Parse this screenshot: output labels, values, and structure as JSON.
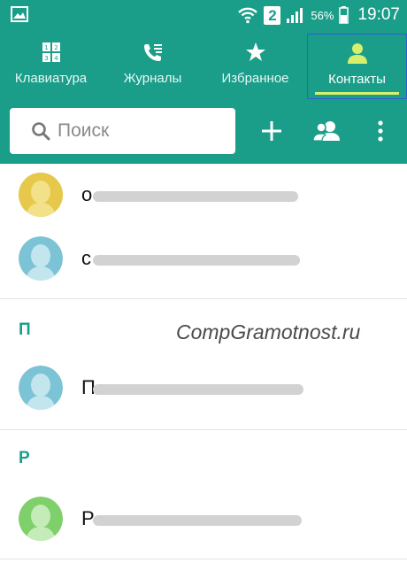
{
  "status_bar": {
    "sim_badge": "2",
    "battery_percent": "56%",
    "time": "19:07",
    "icons": [
      "image-notification-icon",
      "wifi-icon",
      "signal-icon",
      "battery-icon"
    ]
  },
  "tabs": [
    {
      "label": "Клавиатура",
      "icon": "dialpad-icon",
      "active": false
    },
    {
      "label": "Журналы",
      "icon": "call-log-icon",
      "active": false
    },
    {
      "label": "Избранное",
      "icon": "star-icon",
      "active": false
    },
    {
      "label": "Контакты",
      "icon": "contacts-icon",
      "active": true
    }
  ],
  "search": {
    "placeholder": "Поиск",
    "value": ""
  },
  "actions": [
    "add-icon",
    "group-icon",
    "more-icon"
  ],
  "sections": [
    {
      "letter": "",
      "contacts": [
        {
          "initial": "о"
        },
        {
          "initial": "с"
        }
      ]
    },
    {
      "letter": "П",
      "contacts": [
        {
          "initial": "П"
        }
      ]
    },
    {
      "letter": "Р",
      "contacts": [
        {
          "initial": "Р"
        }
      ]
    }
  ],
  "watermark": "CompGramotnost.ru",
  "colors": {
    "primary": "#1a9e8a",
    "active_tab_indicator": "#d7f06b",
    "avatar_yellow": "#e6c84a",
    "avatar_blue": "#7cc3d6",
    "avatar_green": "#7fcf6a"
  }
}
